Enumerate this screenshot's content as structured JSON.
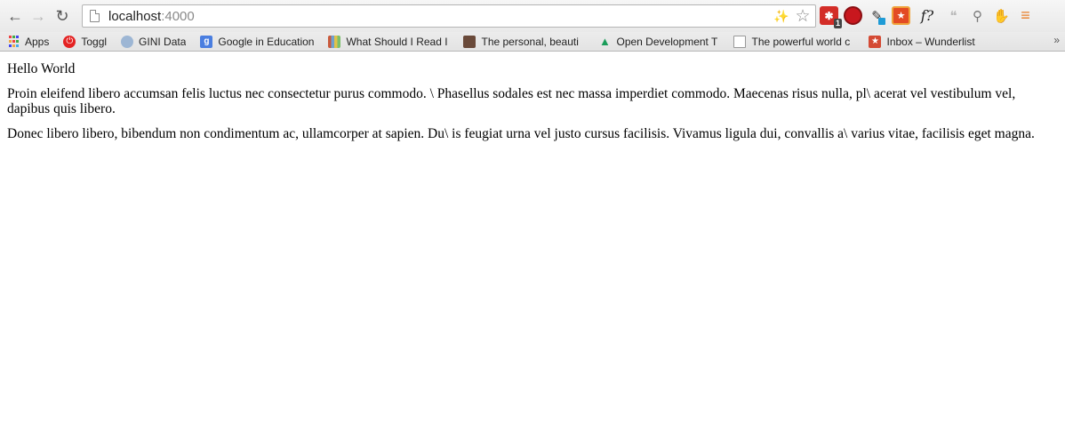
{
  "browser": {
    "url_host": "localhost",
    "url_port": ":4000",
    "navigation": {
      "back": "back-arrow",
      "forward": "forward-arrow",
      "reload": "reload"
    },
    "extensions": [
      {
        "name": "lastpass",
        "glyph": "✱",
        "badge": "1"
      },
      {
        "name": "ublock",
        "glyph": "⬢"
      },
      {
        "name": "color-picker",
        "glyph": "✎"
      },
      {
        "name": "todo",
        "glyph": "★"
      },
      {
        "name": "font-identifier",
        "glyph": "f?"
      },
      {
        "name": "hangouts",
        "glyph": "❝"
      },
      {
        "name": "zoom",
        "glyph": "⚲"
      },
      {
        "name": "extension",
        "glyph": "✋"
      },
      {
        "name": "menu",
        "glyph": "≡"
      }
    ]
  },
  "bookmarks": [
    {
      "label": "Apps",
      "icon": "apps-grid-icon"
    },
    {
      "label": "Toggl",
      "icon": "toggl-icon"
    },
    {
      "label": "GINI Data",
      "icon": "globe-icon"
    },
    {
      "label": "Google in Education",
      "icon": "google-icon"
    },
    {
      "label": "What Should I Read I",
      "icon": "books-icon"
    },
    {
      "label": "The personal, beauti",
      "icon": "coffee-icon"
    },
    {
      "label": "Open Development T",
      "icon": "drive-icon"
    },
    {
      "label": "The powerful world c",
      "icon": "document-icon"
    },
    {
      "label": "Inbox – Wunderlist",
      "icon": "wunderlist-icon"
    }
  ],
  "bookmarks_overflow": "»",
  "page": {
    "heading": "Hello World",
    "paragraphs": [
      "Proin eleifend libero accumsan felis luctus nec consectetur purus commodo. \\ Phasellus sodales est nec massa imperdiet commodo. Maecenas risus nulla, pl\\ acerat vel vestibulum vel, dapibus quis libero.",
      "Donec libero libero, bibendum non condimentum ac, ullamcorper at sapien. Du\\ is feugiat urna vel justo cursus facilisis. Vivamus ligula dui, convallis a\\ varius vitae, facilisis eget magna."
    ]
  },
  "colors": {
    "toolbar_bg": "#ececec",
    "lastpass": "#d32d27",
    "menu": "#e8802a"
  }
}
